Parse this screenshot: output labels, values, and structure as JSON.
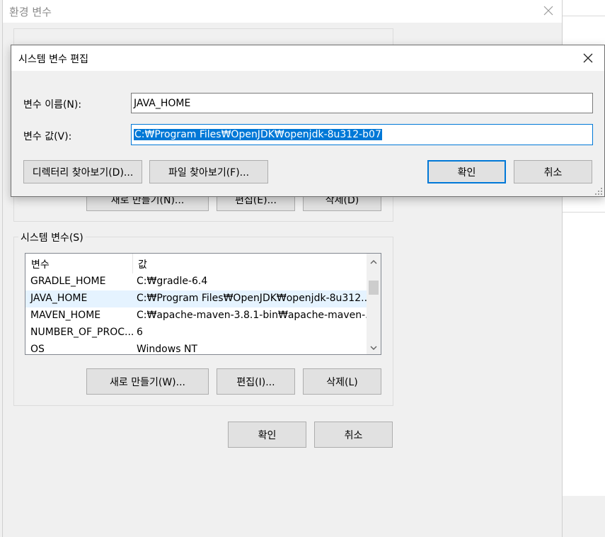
{
  "env_window": {
    "title": "환경 변수",
    "behind_new_button": "새로 만들기(N)...",
    "behind_edit_button": "편집(E)...",
    "behind_delete_button": "삭제(D)",
    "system_group_label": "시스템 변수(S)",
    "table": {
      "col_variable": "변수",
      "col_value": "값",
      "rows": [
        {
          "name": "GRADLE_HOME",
          "value": "C:₩gradle-6.4"
        },
        {
          "name": "JAVA_HOME",
          "value": "C:₩Program Files₩OpenJDK₩openjdk-8u312..."
        },
        {
          "name": "MAVEN_HOME",
          "value": "C:₩apache-maven-3.8.1-bin₩apache-maven-..."
        },
        {
          "name": "NUMBER_OF_PROC...",
          "value": "6"
        },
        {
          "name": "OS",
          "value": "Windows NT"
        }
      ]
    },
    "new_button": "새로 만들기(W)...",
    "edit_button": "편집(I)...",
    "delete_button": "삭제(L)",
    "ok_button": "확인",
    "cancel_button": "취소"
  },
  "edit_dialog": {
    "title": "시스템 변수 편집",
    "name_label": "변수 이름(N):",
    "name_value": "JAVA_HOME",
    "value_label": "변수 값(V):",
    "value_value": "C:₩Program Files₩OpenJDK₩openjdk-8u312-b07",
    "browse_dir_button": "디렉터리 찾아보기(D)...",
    "browse_file_button": "파일 찾아보기(F)...",
    "ok_button": "확인",
    "cancel_button": "취소"
  },
  "colors": {
    "accent": "#0078d7",
    "selection_bg": "#0078d7",
    "row_highlight": "#e5f3ff",
    "button_bg": "#e1e1e1",
    "window_bg": "#f0f0f0"
  }
}
